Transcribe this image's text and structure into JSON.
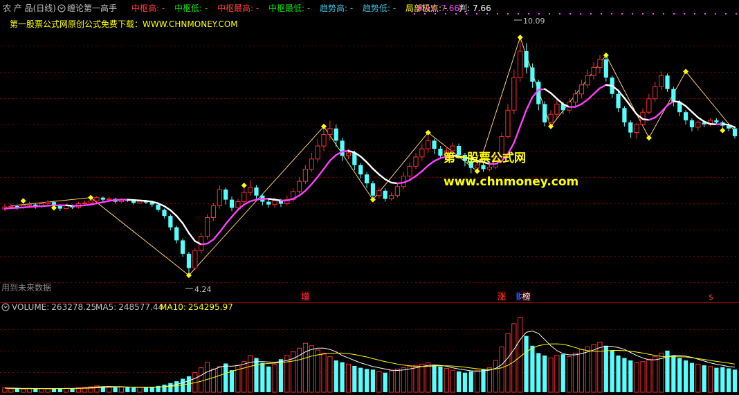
{
  "header": {
    "stock_name": "农 产 品(日线)",
    "indicator_name": "缠论第一高手",
    "items": [
      {
        "label": "中枢高:",
        "value": "-",
        "color": "#ff3c3c"
      },
      {
        "label": "中枢低:",
        "value": "-",
        "color": "#00e000"
      },
      {
        "label": "中枢最高:",
        "value": "-",
        "color": "#ff3c3c"
      },
      {
        "label": "中枢最低:",
        "value": "-",
        "color": "#00e000"
      },
      {
        "label": "趋势高:",
        "value": "-",
        "color": "#40c0e0"
      },
      {
        "label": "趋势低:",
        "value": "-",
        "color": "#40c0e0"
      },
      {
        "label": "局部极点:",
        "value": "-",
        "color": "#ffff00"
      }
    ],
    "ma5": {
      "label": "MA5:",
      "value": "7.66",
      "color": "#ff40ff"
    },
    "pan": {
      "label": "判:",
      "value": "7.66",
      "color": "#ffffff"
    }
  },
  "banner": "第一股票公式网原创公式免费下载：WWW.CHNMONEY.COM",
  "watermark": {
    "cn": "第一股票公式网",
    "url": "www.chnmoney.com"
  },
  "future_data_note": "用到未来数据",
  "event_tags": [
    {
      "text": "增",
      "color": "#ff4040",
      "bg": "#300000",
      "index": 49
    },
    {
      "text": "涨",
      "color": "#ff4040",
      "bg": "#300000",
      "index": 81
    },
    {
      "text": "财",
      "color": "#6090ff",
      "bg": "#000030",
      "index": 84
    },
    {
      "text": "榜",
      "color": "#ffffff",
      "bg": "#300000",
      "index": 85
    }
  ],
  "tail_marker": {
    "text": "$",
    "color": "#ff4040"
  },
  "price_annotations": {
    "high": "10.09",
    "low": "4.24"
  },
  "volume_header": {
    "volume": {
      "label": "VOLUME:",
      "value": "263278.25",
      "color": "#c0c0c0"
    },
    "ma5": {
      "label": "MA5:",
      "value": "248577.44",
      "color": "#c0c0c0"
    },
    "ma10": {
      "label": "MA10:",
      "value": "254295.97",
      "color": "#ffff00"
    }
  },
  "colors": {
    "up": "#ff3030",
    "down": "#54ffff",
    "ma": "#ff40ff",
    "ma_line": "#ffffff",
    "zigzag": "#ffd070",
    "grid": "#7a0000"
  },
  "chart_data": {
    "type": "candlestick",
    "price_range": [
      3.9,
      10.6
    ],
    "volume_range": [
      0,
      650000
    ],
    "high_label": 10.09,
    "low_label": 4.24,
    "candles": [
      [
        5.87,
        5.92,
        5.99,
        5.82
      ],
      [
        5.92,
        5.94,
        6.0,
        5.88
      ],
      [
        5.94,
        5.9,
        5.98,
        5.85
      ],
      [
        5.9,
        5.96,
        6.02,
        5.87
      ],
      [
        5.96,
        5.98,
        6.05,
        5.92
      ],
      [
        5.98,
        5.93,
        6.02,
        5.88
      ],
      [
        5.93,
        6.0,
        6.05,
        5.89
      ],
      [
        6.0,
        6.04,
        6.09,
        5.96
      ],
      [
        6.04,
        5.97,
        6.07,
        5.93
      ],
      [
        5.97,
        5.88,
        5.99,
        5.82
      ],
      [
        5.88,
        5.95,
        6.0,
        5.85
      ],
      [
        5.95,
        5.91,
        5.98,
        5.87
      ],
      [
        5.91,
        6.0,
        6.05,
        5.88
      ],
      [
        6.0,
        6.02,
        6.08,
        5.96
      ],
      [
        6.02,
        6.07,
        6.12,
        5.98
      ],
      [
        6.07,
        6.15,
        6.2,
        6.02
      ],
      [
        6.15,
        6.1,
        6.18,
        6.05
      ],
      [
        6.1,
        6.12,
        6.17,
        6.06
      ],
      [
        6.12,
        6.05,
        6.14,
        6.0
      ],
      [
        6.05,
        6.09,
        6.13,
        6.02
      ],
      [
        6.09,
        6.08,
        6.12,
        6.04
      ],
      [
        6.08,
        6.02,
        6.1,
        5.98
      ],
      [
        6.02,
        6.06,
        6.1,
        5.99
      ],
      [
        6.06,
        6.03,
        6.09,
        5.99
      ],
      [
        6.03,
        5.98,
        6.05,
        5.92
      ],
      [
        5.98,
        5.85,
        6.0,
        5.8
      ],
      [
        5.85,
        5.7,
        5.88,
        5.64
      ],
      [
        5.7,
        5.42,
        5.74,
        5.35
      ],
      [
        5.42,
        5.1,
        5.46,
        5.02
      ],
      [
        5.1,
        4.77,
        5.15,
        4.7
      ],
      [
        4.77,
        4.42,
        4.82,
        4.24
      ],
      [
        4.42,
        4.85,
        4.92,
        4.36
      ],
      [
        4.85,
        5.2,
        5.28,
        4.78
      ],
      [
        5.2,
        5.66,
        5.74,
        5.12
      ],
      [
        5.66,
        5.95,
        6.02,
        5.58
      ],
      [
        5.95,
        6.35,
        6.45,
        5.88
      ],
      [
        6.35,
        6.1,
        6.4,
        5.98
      ],
      [
        6.1,
        5.9,
        6.18,
        5.82
      ],
      [
        5.9,
        6.05,
        6.12,
        5.84
      ],
      [
        6.05,
        6.28,
        6.42,
        6.0
      ],
      [
        6.28,
        6.4,
        6.58,
        6.2
      ],
      [
        6.4,
        6.2,
        6.46,
        6.12
      ],
      [
        6.2,
        6.05,
        6.25,
        5.96
      ],
      [
        6.05,
        5.98,
        6.12,
        5.9
      ],
      [
        5.98,
        6.08,
        6.15,
        5.9
      ],
      [
        6.08,
        6.0,
        6.12,
        5.92
      ],
      [
        6.0,
        6.1,
        6.2,
        5.95
      ],
      [
        6.1,
        6.3,
        6.38,
        6.04
      ],
      [
        6.3,
        6.55,
        6.65,
        6.25
      ],
      [
        6.55,
        6.85,
        6.95,
        6.48
      ],
      [
        6.85,
        7.1,
        7.25,
        6.78
      ],
      [
        7.1,
        7.42,
        7.58,
        7.02
      ],
      [
        7.42,
        7.7,
        7.9,
        7.3
      ],
      [
        7.7,
        7.85,
        8.04,
        7.55
      ],
      [
        7.85,
        7.55,
        7.95,
        7.4
      ],
      [
        7.55,
        7.18,
        7.62,
        7.05
      ],
      [
        7.18,
        7.25,
        7.35,
        7.1
      ],
      [
        7.25,
        6.95,
        7.3,
        6.82
      ],
      [
        6.95,
        6.72,
        7.0,
        6.62
      ],
      [
        6.72,
        6.5,
        6.78,
        6.38
      ],
      [
        6.5,
        6.2,
        6.56,
        6.1
      ],
      [
        6.2,
        6.32,
        6.4,
        6.12
      ],
      [
        6.32,
        6.12,
        6.38,
        6.05
      ],
      [
        6.12,
        6.2,
        6.28,
        6.08
      ],
      [
        6.2,
        6.42,
        6.52,
        6.15
      ],
      [
        6.42,
        6.68,
        6.78,
        6.35
      ],
      [
        6.68,
        6.92,
        7.02,
        6.6
      ],
      [
        6.92,
        7.15,
        7.25,
        6.85
      ],
      [
        7.15,
        7.35,
        7.48,
        7.05
      ],
      [
        7.35,
        7.55,
        7.75,
        7.25
      ],
      [
        7.55,
        7.35,
        7.6,
        7.22
      ],
      [
        7.35,
        7.18,
        7.42,
        7.1
      ],
      [
        7.18,
        7.3,
        7.4,
        7.1
      ],
      [
        7.3,
        7.42,
        7.5,
        7.2
      ],
      [
        7.42,
        7.2,
        7.48,
        7.1
      ],
      [
        7.2,
        7.05,
        7.25,
        6.92
      ],
      [
        7.05,
        6.88,
        7.1,
        6.75
      ],
      [
        6.88,
        6.95,
        7.02,
        6.8
      ],
      [
        6.95,
        6.85,
        7.0,
        6.78
      ],
      [
        6.85,
        6.9,
        6.96,
        6.8
      ],
      [
        6.9,
        7.15,
        7.25,
        6.85
      ],
      [
        7.15,
        7.65,
        7.75,
        7.1
      ],
      [
        7.65,
        8.3,
        8.45,
        7.6
      ],
      [
        8.3,
        9.1,
        9.3,
        8.2
      ],
      [
        9.1,
        9.75,
        10.09,
        9.0
      ],
      [
        9.75,
        9.35,
        9.95,
        9.2
      ],
      [
        9.35,
        9.0,
        9.45,
        8.85
      ],
      [
        9.0,
        8.45,
        9.05,
        8.3
      ],
      [
        8.45,
        8.0,
        8.52,
        7.9
      ],
      [
        8.0,
        8.2,
        8.3,
        7.92
      ],
      [
        8.2,
        8.45,
        8.55,
        8.1
      ],
      [
        8.45,
        8.3,
        8.5,
        8.2
      ],
      [
        8.3,
        8.5,
        8.6,
        8.22
      ],
      [
        8.5,
        8.7,
        8.8,
        8.4
      ],
      [
        8.7,
        8.92,
        9.05,
        8.6
      ],
      [
        8.92,
        9.15,
        9.3,
        8.85
      ],
      [
        9.15,
        9.35,
        9.48,
        9.05
      ],
      [
        9.35,
        9.55,
        9.65,
        9.2
      ],
      [
        9.55,
        9.1,
        9.6,
        9.0
      ],
      [
        9.1,
        8.7,
        9.15,
        8.6
      ],
      [
        8.7,
        8.35,
        8.75,
        8.25
      ],
      [
        8.35,
        8.0,
        8.4,
        7.9
      ],
      [
        8.0,
        7.75,
        8.05,
        7.62
      ],
      [
        7.75,
        7.95,
        8.0,
        7.6
      ],
      [
        7.95,
        8.25,
        8.35,
        7.9
      ],
      [
        8.25,
        8.58,
        8.7,
        8.2
      ],
      [
        8.58,
        8.88,
        9.0,
        8.5
      ],
      [
        8.88,
        9.15,
        9.25,
        8.8
      ],
      [
        9.15,
        8.82,
        9.2,
        8.75
      ],
      [
        8.82,
        8.5,
        8.88,
        8.4
      ],
      [
        8.5,
        8.25,
        8.55,
        8.15
      ],
      [
        8.25,
        8.05,
        8.3,
        7.95
      ],
      [
        8.05,
        7.88,
        8.1,
        7.78
      ],
      [
        7.88,
        8.0,
        8.05,
        7.8
      ],
      [
        8.0,
        7.95,
        8.05,
        7.88
      ],
      [
        7.95,
        8.05,
        8.1,
        7.9
      ],
      [
        8.05,
        8.0,
        8.1,
        7.95
      ],
      [
        8.0,
        7.92,
        8.04,
        7.85
      ],
      [
        7.92,
        7.85,
        7.96,
        7.78
      ],
      [
        7.85,
        7.66,
        7.88,
        7.6
      ]
    ],
    "volumes": [
      35000,
      28000,
      30000,
      26000,
      32000,
      29000,
      31000,
      27000,
      30000,
      34000,
      33000,
      28000,
      36000,
      40000,
      45000,
      52000,
      48000,
      42000,
      39000,
      44000,
      41000,
      38000,
      40000,
      37000,
      42000,
      52000,
      62000,
      75000,
      90000,
      110000,
      130000,
      160000,
      200000,
      245000,
      190000,
      210000,
      235000,
      180000,
      220000,
      250000,
      300000,
      280000,
      240000,
      210000,
      230000,
      270000,
      300000,
      330000,
      360000,
      400000,
      380000,
      345000,
      320000,
      290000,
      260000,
      245000,
      230000,
      215000,
      200000,
      190000,
      185000,
      170000,
      160000,
      175000,
      190000,
      200000,
      210000,
      220000,
      230000,
      240000,
      225000,
      210000,
      195000,
      180000,
      170000,
      160000,
      170000,
      180000,
      190000,
      200000,
      260000,
      370000,
      480000,
      560000,
      610000,
      460000,
      380000,
      320000,
      300000,
      280000,
      300000,
      310000,
      290000,
      320000,
      350000,
      370000,
      390000,
      410000,
      380000,
      340000,
      300000,
      280000,
      260000,
      240000,
      250000,
      270000,
      290000,
      320000,
      340000,
      300000,
      280000,
      260000,
      240000,
      230000,
      220000,
      210000,
      200000,
      205000,
      195000,
      185000
    ],
    "vol_ma5": [
      33000,
      32000,
      31000,
      30000,
      30000,
      30000,
      30000,
      30500,
      30000,
      31000,
      31000,
      31500,
      32500,
      34500,
      38000,
      43000,
      46000,
      47000,
      46000,
      45000,
      43000,
      41000,
      40000,
      39000,
      40000,
      42000,
      46000,
      53000,
      64000,
      78000,
      94000,
      113000,
      138000,
      167000,
      185000,
      205000,
      215000,
      213000,
      218000,
      230000,
      245000,
      250000,
      250000,
      247000,
      245000,
      250000,
      260000,
      275000,
      300000,
      330000,
      350000,
      360000,
      360000,
      350000,
      330000,
      300000,
      280000,
      260000,
      240000,
      225000,
      210000,
      200000,
      190000,
      180000,
      178000,
      182000,
      190000,
      200000,
      210000,
      220000,
      222000,
      220000,
      212000,
      200000,
      190000,
      182000,
      175000,
      172000,
      175000,
      180000,
      195000,
      225000,
      280000,
      350000,
      430000,
      490000,
      500000,
      480000,
      430000,
      380000,
      340000,
      315000,
      305000,
      305000,
      315000,
      330000,
      345000,
      365000,
      375000,
      375000,
      365000,
      350000,
      325000,
      300000,
      280000,
      265000,
      265000,
      275000,
      290000,
      300000,
      300000,
      295000,
      285000,
      270000,
      255000,
      240000,
      228000,
      220000,
      210000,
      205000
    ],
    "vol_ma10": [
      35000,
      34000,
      33000,
      32000,
      31500,
      31000,
      30800,
      30600,
      30500,
      30600,
      30800,
      31000,
      31500,
      32500,
      34000,
      36500,
      39000,
      41000,
      42000,
      42500,
      42500,
      42000,
      41500,
      41000,
      41500,
      42500,
      44500,
      48000,
      53000,
      60000,
      68000,
      78000,
      90000,
      105000,
      120000,
      137000,
      155000,
      170000,
      185000,
      198000,
      212000,
      222000,
      230000,
      235000,
      238000,
      242000,
      248000,
      255000,
      265000,
      280000,
      295000,
      305000,
      312000,
      318000,
      320000,
      320000,
      316000,
      308000,
      298000,
      288000,
      275000,
      262000,
      250000,
      240000,
      230000,
      222000,
      216000,
      212000,
      210000,
      212000,
      214000,
      216000,
      216000,
      214000,
      210000,
      205000,
      198000,
      192000,
      188000,
      186000,
      190000,
      200000,
      220000,
      250000,
      290000,
      330000,
      360000,
      380000,
      390000,
      395000,
      395000,
      392000,
      380000,
      365000,
      350000,
      340000,
      335000,
      335000,
      338000,
      342000,
      342000,
      340000,
      335000,
      328000,
      320000,
      310000,
      300000,
      293000,
      290000,
      290000,
      290000,
      288000,
      282000,
      275000,
      268000,
      260000,
      252000,
      245000,
      238000,
      230000
    ],
    "ma_line": [
      5.88,
      5.89,
      5.9,
      5.91,
      5.92,
      5.93,
      5.94,
      5.95,
      5.96,
      5.96,
      5.96,
      5.95,
      5.95,
      5.96,
      5.98,
      6.01,
      6.04,
      6.07,
      6.09,
      6.1,
      6.1,
      6.09,
      6.08,
      6.07,
      6.05,
      6.01,
      5.94,
      5.84,
      5.7,
      5.52,
      5.28,
      5.08,
      5.0,
      5.02,
      5.12,
      5.3,
      5.5,
      5.68,
      5.85,
      5.98,
      6.06,
      6.1,
      6.12,
      6.12,
      6.1,
      6.08,
      6.08,
      6.12,
      6.2,
      6.32,
      6.48,
      6.66,
      6.86,
      7.06,
      7.2,
      7.28,
      7.3,
      7.26,
      7.16,
      7.02,
      6.86,
      6.72,
      6.6,
      6.52,
      6.5,
      6.52,
      6.58,
      6.68,
      6.8,
      6.94,
      7.05,
      7.12,
      7.16,
      7.18,
      7.17,
      7.14,
      7.1,
      7.06,
      7.02,
      6.98,
      6.98,
      7.05,
      7.22,
      7.5,
      7.9,
      8.3,
      8.62,
      8.8,
      8.82,
      8.72,
      8.58,
      8.45,
      8.38,
      8.38,
      8.45,
      8.56,
      8.7,
      8.84,
      8.92,
      8.9,
      8.78,
      8.6,
      8.4,
      8.2,
      8.08,
      8.06,
      8.12,
      8.25,
      8.42,
      8.52,
      8.5,
      8.4,
      8.26,
      8.12,
      8.02,
      7.96,
      7.95,
      7.96,
      7.94,
      7.88
    ],
    "zigzag": [
      [
        1,
        5.95
      ],
      [
        14,
        6.15
      ],
      [
        30,
        4.24
      ],
      [
        52,
        7.9
      ],
      [
        60,
        6.1
      ],
      [
        69,
        7.75
      ],
      [
        77,
        6.8
      ],
      [
        84,
        10.09
      ],
      [
        89,
        7.9
      ],
      [
        98,
        9.65
      ],
      [
        105,
        7.62
      ],
      [
        111,
        9.25
      ],
      [
        119,
        7.78
      ]
    ],
    "dot_points": [
      [
        3,
        6.07
      ],
      [
        14,
        6.15
      ],
      [
        8,
        5.9
      ],
      [
        30,
        4.24
      ],
      [
        39,
        6.45
      ],
      [
        52,
        7.9
      ],
      [
        60,
        6.1
      ],
      [
        69,
        7.75
      ],
      [
        77,
        6.8
      ],
      [
        84,
        10.09
      ],
      [
        89,
        7.9
      ],
      [
        98,
        9.65
      ],
      [
        105,
        7.62
      ],
      [
        111,
        9.25
      ],
      [
        117,
        7.8
      ]
    ]
  }
}
